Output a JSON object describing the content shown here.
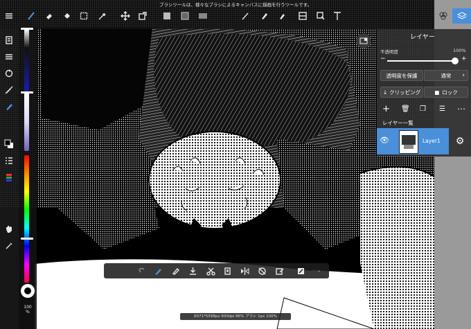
{
  "app": {
    "hint_text": "ブラシツールは、様々なブラシによるキャンバスに描画を行うツールです。",
    "status_text": "6071*5598px 600dpi 86% ブラシ 1px 100%"
  },
  "left_panel": {
    "zoom_percent": "100",
    "zoom_unit": "%"
  },
  "layer_panel": {
    "title": "レイヤー",
    "opacity_label": "不透明度",
    "opacity_value": "100%",
    "opacity_level": 1.0,
    "protect_alpha_label": "透明度を保護",
    "blend_mode_label": "通常",
    "clipping_label": "クリッピング",
    "lock_label": "ロック",
    "list_title": "レイヤー一覧",
    "layers": [
      {
        "name": "Layer1",
        "visible": true,
        "selected": true
      }
    ]
  },
  "colors": {
    "accent": "#4a8fd9",
    "panel_bg": "#303030",
    "current_color": "#000000"
  },
  "icons": {
    "top_tools": [
      "menu-icon",
      "brush-icon",
      "eraser-icon",
      "fill-bucket-icon",
      "select-rect-icon",
      "magic-wand-icon",
      "move-icon",
      "transform-icon",
      "fill-color-icon",
      "gradient-icon",
      "blur-icon",
      "fingers-icon",
      "text-icon",
      "frame-icon",
      "layers-icon"
    ]
  }
}
